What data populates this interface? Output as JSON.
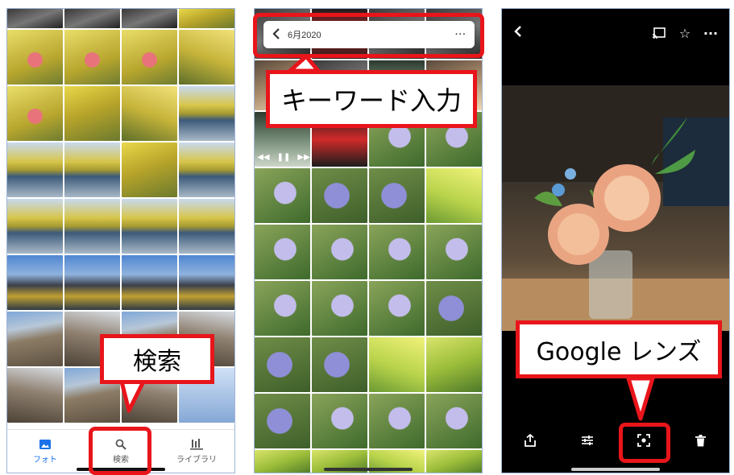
{
  "panel1": {
    "nav": [
      {
        "label": "フォト",
        "icon": "photo-icon",
        "active": true
      },
      {
        "label": "検索",
        "icon": "search-icon",
        "active": false
      },
      {
        "label": "ライブラリ",
        "icon": "library-icon",
        "active": false
      }
    ],
    "callout": "検索"
  },
  "panel2": {
    "search_query": "6月2020",
    "callout": "キーワード入力"
  },
  "panel3": {
    "callout": "Google レンズ"
  },
  "colors": {
    "callout_border": "#e8151b",
    "active_nav": "#1a73e8",
    "panel_border": "#9fb4d6"
  }
}
